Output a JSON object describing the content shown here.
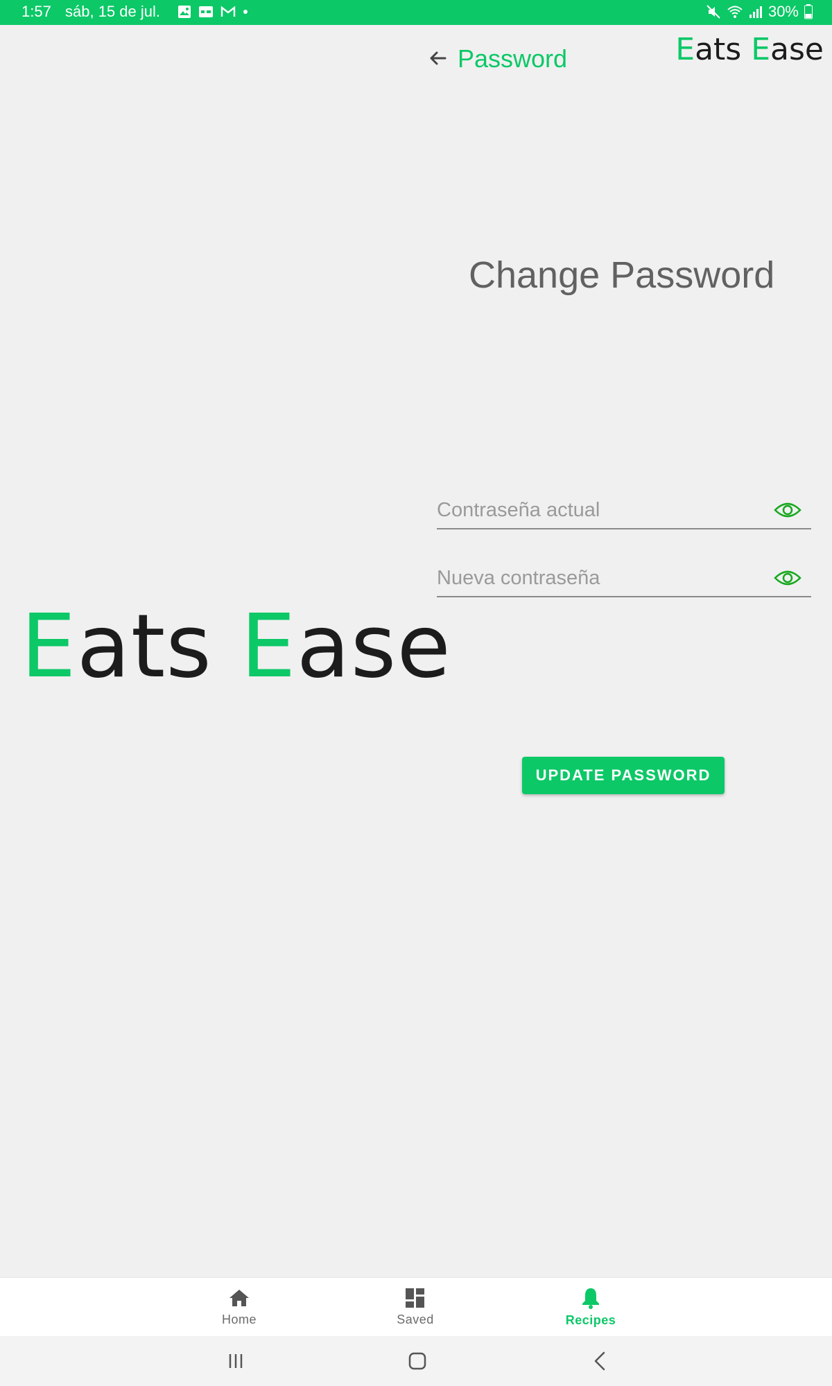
{
  "status_bar": {
    "time": "1:57",
    "date": "sáb, 15 de jul.",
    "battery": "30%",
    "icons": [
      "gallery-icon",
      "hotel-icon",
      "gmail-icon",
      "dot-icon",
      "mute-icon",
      "wifi-icon",
      "signal-icon",
      "battery-icon"
    ]
  },
  "header": {
    "back_icon": "arrow-left-icon",
    "title": "Password",
    "logo_first": "E",
    "logo_rest1": "ats ",
    "logo_second": "E",
    "logo_rest2": "ase"
  },
  "side_logo": {
    "first": "E",
    "rest1": "ats ",
    "second": "E",
    "rest2": "ase"
  },
  "form": {
    "heading": "Change Password",
    "current_password_placeholder": "Contraseña actual",
    "new_password_placeholder": "Nueva contraseña",
    "submit_label": "UPDATE PASSWORD"
  },
  "bottom_nav": {
    "items": [
      {
        "label": "Home",
        "icon": "home-icon",
        "active": false
      },
      {
        "label": "Saved",
        "icon": "dashboard-icon",
        "active": false
      },
      {
        "label": "Recipes",
        "icon": "bell-icon",
        "active": true
      }
    ]
  },
  "colors": {
    "brand": "#0cc867",
    "background": "#f0f0f0",
    "heading": "#616161"
  }
}
